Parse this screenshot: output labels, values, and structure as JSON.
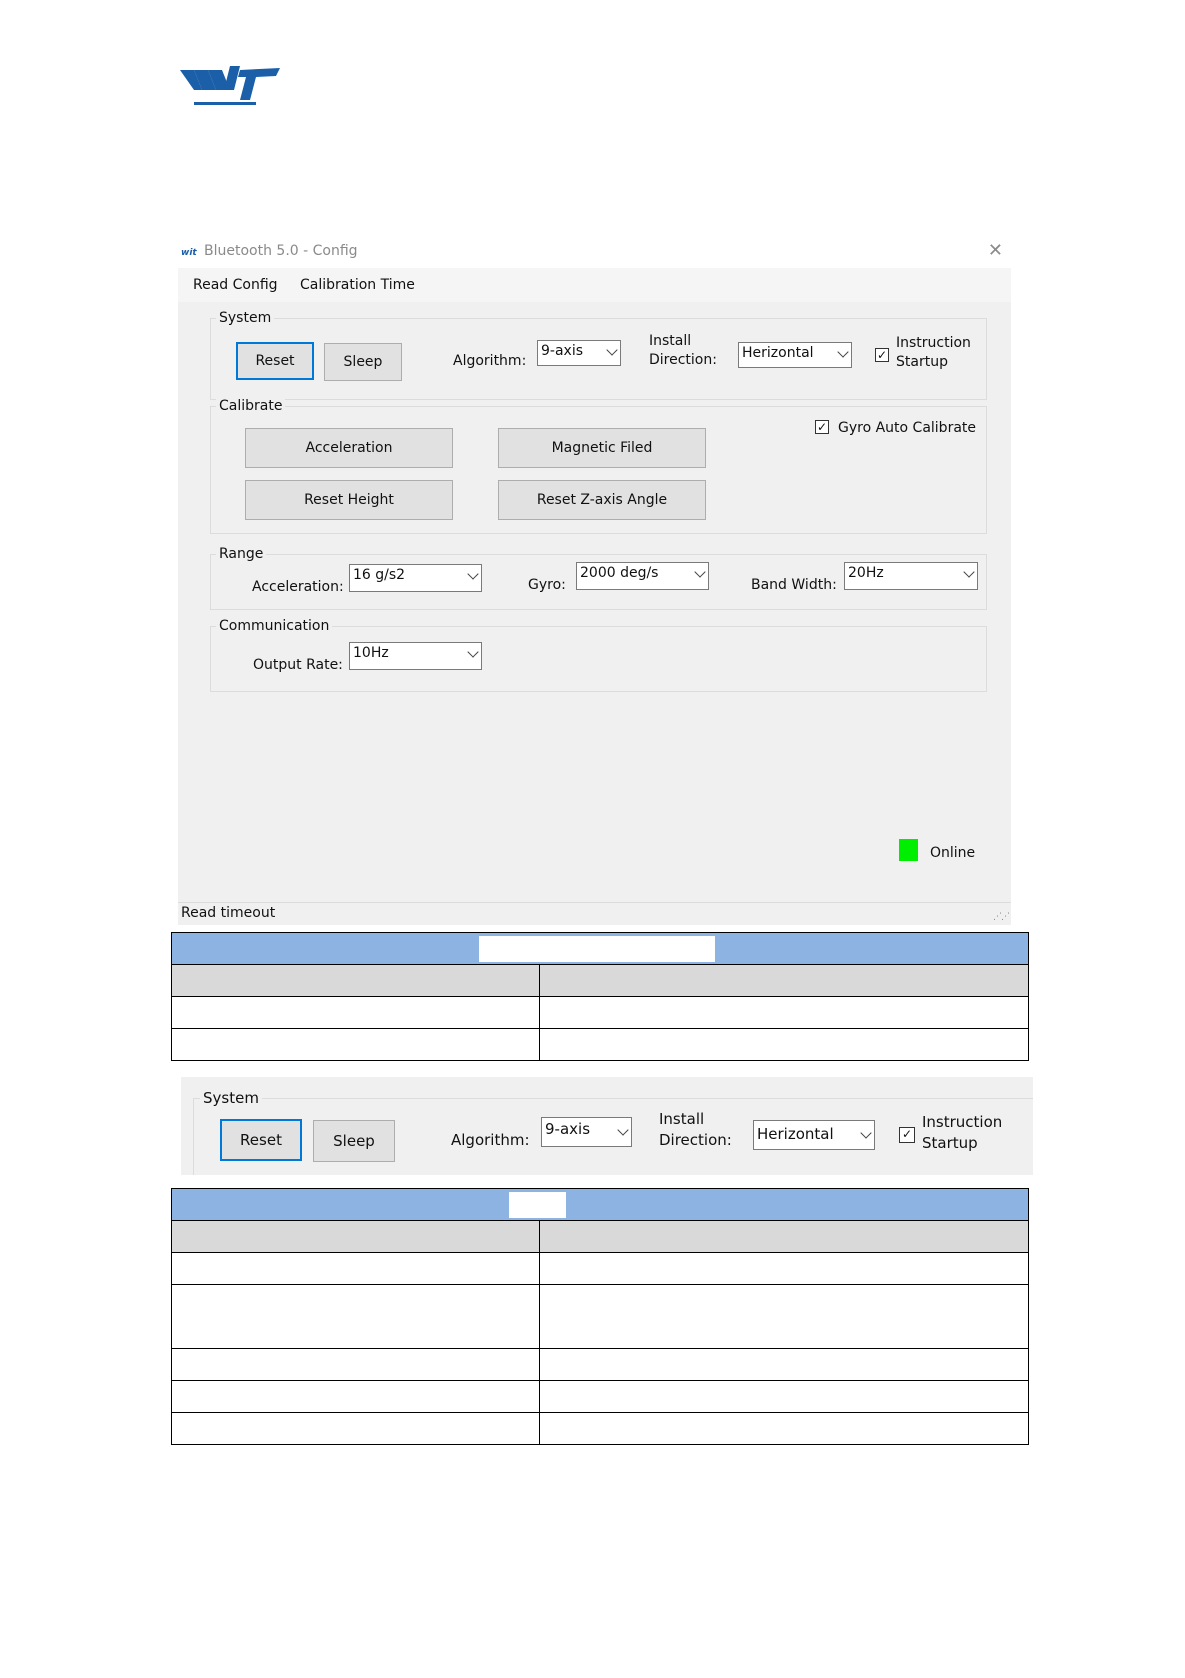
{
  "window": {
    "title": "Bluetooth 5.0 - Config",
    "close_icon": "close-icon",
    "menu": [
      "Read Config",
      "Calibration Time"
    ],
    "system": {
      "label": "System",
      "reset": "Reset",
      "sleep": "Sleep",
      "algorithm_label": "Algorithm:",
      "algorithm_value": "9-axis",
      "install_label_1": "Install",
      "install_label_2": "Direction:",
      "install_value": "Herizontal",
      "instruction_label_1": "Instruction",
      "instruction_label_2": "Startup",
      "instruction_checked": true
    },
    "calibrate": {
      "label": "Calibrate",
      "acceleration": "Acceleration",
      "magnetic": "Magnetic Filed",
      "reset_height": "Reset Height",
      "reset_z": "Reset Z-axis Angle",
      "gyro_auto": "Gyro Auto Calibrate",
      "gyro_auto_checked": true
    },
    "range": {
      "label": "Range",
      "acc_label": "Acceleration:",
      "acc_value": "16 g/s2",
      "gyro_label": "Gyro:",
      "gyro_value": "2000 deg/s",
      "bw_label": "Band Width:",
      "bw_value": "20Hz"
    },
    "communication": {
      "label": "Communication",
      "rate_label": "Output Rate:",
      "rate_value": "10Hz"
    },
    "status": {
      "online": "Online",
      "online_color": "#00ee00",
      "footer": "Read timeout"
    }
  },
  "colors": {
    "table_header": "#8db3e2",
    "table_subheader": "#d9d9d9",
    "button_border_focus": "#0078d7"
  }
}
